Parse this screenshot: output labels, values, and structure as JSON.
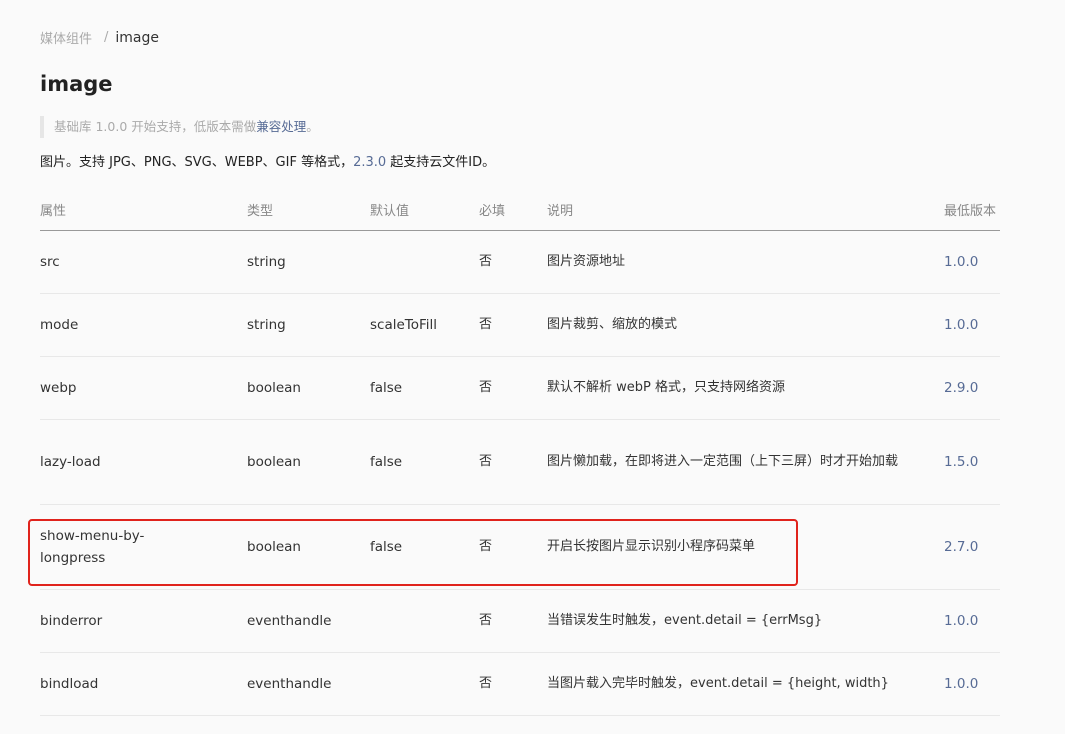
{
  "breadcrumb": {
    "parent": "媒体组件",
    "separator": "/",
    "current": "image"
  },
  "page_title": "image",
  "tip": {
    "prefix": "基础库 1.0.0 开始支持，低版本需做",
    "link": "兼容处理",
    "suffix": "。"
  },
  "description": {
    "prefix": "图片。支持 JPG、PNG、SVG、WEBP、GIF 等格式，",
    "version_link": "2.3.0",
    "suffix": " 起支持云文件ID。"
  },
  "table": {
    "headers": {
      "attr": "属性",
      "type": "类型",
      "default": "默认值",
      "required": "必填",
      "desc": "说明",
      "min_version": "最低版本"
    },
    "rows": [
      {
        "attr": "src",
        "type": "string",
        "default": "",
        "required": "否",
        "desc": "图片资源地址",
        "min_version": "1.0.0"
      },
      {
        "attr": "mode",
        "type": "string",
        "default": "scaleToFill",
        "required": "否",
        "desc": "图片裁剪、缩放的模式",
        "min_version": "1.0.0"
      },
      {
        "attr": "webp",
        "type": "boolean",
        "default": "false",
        "required": "否",
        "desc": "默认不解析 webP 格式，只支持网络资源",
        "min_version": "2.9.0"
      },
      {
        "attr": "lazy-load",
        "type": "boolean",
        "default": "false",
        "required": "否",
        "desc": "图片懒加载，在即将进入一定范围（上下三屏）时才开始加载",
        "min_version": "1.5.0"
      },
      {
        "attr": "show-menu-by-longpress",
        "type": "boolean",
        "default": "false",
        "required": "否",
        "desc": "开启长按图片显示识别小程序码菜单",
        "min_version": "2.7.0"
      },
      {
        "attr": "binderror",
        "type": "eventhandle",
        "default": "",
        "required": "否",
        "desc": "当错误发生时触发，event.detail = {errMsg}",
        "min_version": "1.0.0"
      },
      {
        "attr": "bindload",
        "type": "eventhandle",
        "default": "",
        "required": "否",
        "desc": "当图片载入完毕时触发，event.detail = {height, width}",
        "min_version": "1.0.0"
      }
    ]
  },
  "colors": {
    "link": "#576b95",
    "highlight": "#e0231c"
  }
}
